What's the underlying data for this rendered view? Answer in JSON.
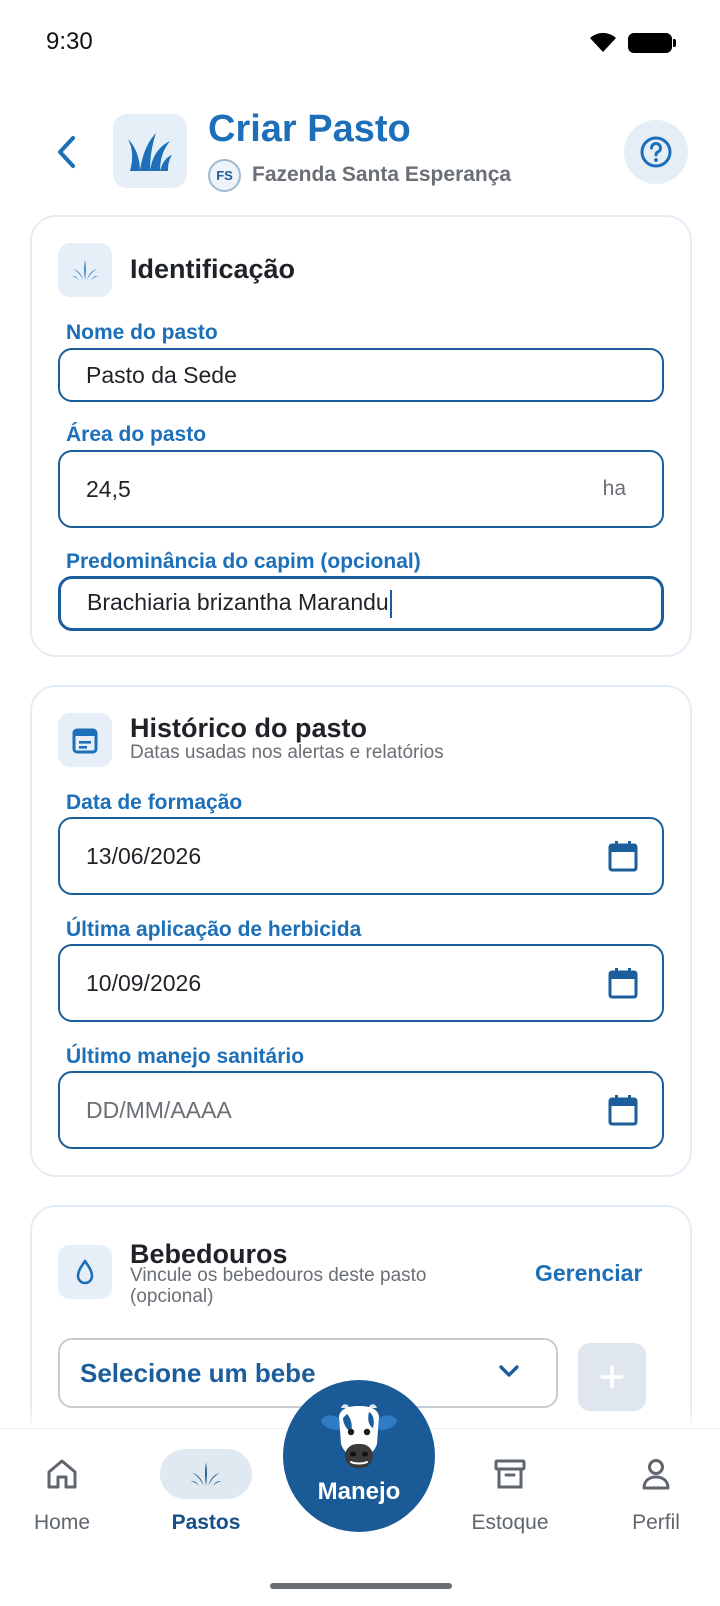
{
  "status_bar": {
    "time": "9:30"
  },
  "header": {
    "title": "Criar Pasto",
    "farm_initials": "FS",
    "farm_name": "Fazenda Santa Esperança"
  },
  "identificacao": {
    "title": "Identificação",
    "nome_label": "Nome do pasto",
    "nome_value": "Pasto da Sede",
    "area_label": "Área do pasto",
    "area_value": "24,5",
    "area_unit": "ha",
    "capim_label": "Predominância do capim (opcional)",
    "capim_value": "Brachiaria brizantha Marandu"
  },
  "historico": {
    "title": "Histórico do pasto",
    "subtitle": "Datas usadas nos alertas e relatórios",
    "formacao_label": "Data de formação",
    "formacao_value": "13/06/2026",
    "herbicida_label": "Última aplicação de herbicida",
    "herbicida_value": "10/09/2026",
    "sanitario_label": "Último manejo sanitário",
    "sanitario_placeholder": "DD/MM/AAAA"
  },
  "bebedouros": {
    "title": "Bebedouros",
    "subtitle": "Vincule os bebedouros deste pasto (opcional)",
    "manage_label": "Gerenciar",
    "select_placeholder": "Selecione um bebe"
  },
  "bottom_nav": {
    "items": [
      {
        "label": "Home",
        "icon": "home-icon"
      },
      {
        "label": "Pastos",
        "icon": "grass-icon",
        "active": true
      },
      {
        "label": "Estoque",
        "icon": "archive-icon"
      },
      {
        "label": "Perfil",
        "icon": "person-icon"
      }
    ],
    "fab_label": "Manejo"
  },
  "colors": {
    "primary": "#1c6fb8",
    "primary_dark": "#1a5a96",
    "tile_bg": "#e6eff8"
  }
}
